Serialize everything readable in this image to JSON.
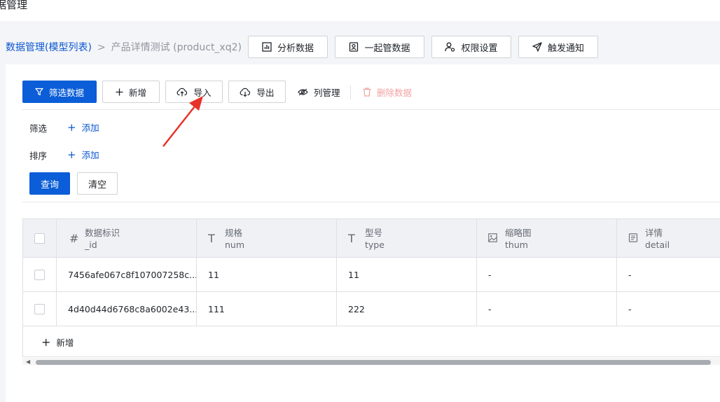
{
  "app": {
    "title": "据管理"
  },
  "breadcrumb": {
    "root": "数据管理(模型列表)",
    "separator": ">",
    "current": "产品详情测试 (product_xq2)"
  },
  "header_buttons": [
    {
      "label": "分析数据",
      "icon": "bar-chart-icon"
    },
    {
      "label": "一起管数据",
      "icon": "user-card-icon"
    },
    {
      "label": "权限设置",
      "icon": "user-gear-icon"
    },
    {
      "label": "触发通知",
      "icon": "send-icon"
    }
  ],
  "toolbar": {
    "filter_data": "筛选数据",
    "add": "新增",
    "import": "导入",
    "export": "导出",
    "columns": "列管理",
    "delete": "删除数据"
  },
  "filter": {
    "filter_label": "筛选",
    "sort_label": "排序",
    "add_label": "添加",
    "query": "查询",
    "clear": "清空"
  },
  "table": {
    "columns": [
      {
        "icon": "#",
        "name": "数据标识",
        "key": "_id"
      },
      {
        "icon": "T",
        "name": "规格",
        "key": "num"
      },
      {
        "icon": "T",
        "name": "型号",
        "key": "type"
      },
      {
        "icon": "image",
        "name": "缩略图",
        "key": "thum"
      },
      {
        "icon": "rich",
        "name": "详情",
        "key": "detail"
      }
    ],
    "rows": [
      [
        "7456afe067c8f107007258c...",
        "11",
        "11",
        "-",
        "-"
      ],
      [
        "4d40d44d6768c8a6002e43...",
        "111",
        "222",
        "-",
        "-"
      ]
    ],
    "add_row": "新增"
  },
  "colors": {
    "primary": "#0b5ed7",
    "link": "#0b57d0",
    "danger_disabled": "#f2a3a3",
    "annotation": "#e8332a"
  }
}
